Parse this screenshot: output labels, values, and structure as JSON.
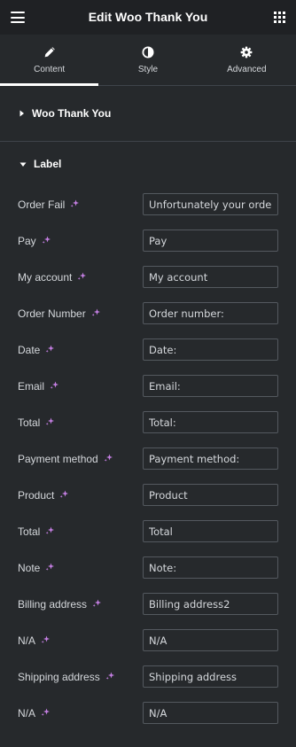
{
  "header": {
    "title": "Edit Woo Thank You"
  },
  "tabs": [
    {
      "label": "Content",
      "icon": "pencil-icon",
      "active": true
    },
    {
      "label": "Style",
      "icon": "contrast-icon",
      "active": false
    },
    {
      "label": "Advanced",
      "icon": "gear-icon",
      "active": false
    }
  ],
  "sections": {
    "woo": {
      "title": "Woo Thank You",
      "expanded": false
    },
    "label": {
      "title": "Label",
      "expanded": true
    }
  },
  "fields": [
    {
      "label": "Order Fail",
      "value": "Unfortunately your order"
    },
    {
      "label": "Pay",
      "value": "Pay"
    },
    {
      "label": "My account",
      "value": "My account"
    },
    {
      "label": "Order Number",
      "value": "Order number:"
    },
    {
      "label": "Date",
      "value": "Date:"
    },
    {
      "label": "Email",
      "value": "Email:"
    },
    {
      "label": "Total",
      "value": "Total:"
    },
    {
      "label": "Payment method",
      "value": "Payment method:"
    },
    {
      "label": "Product",
      "value": "Product"
    },
    {
      "label": "Total",
      "value": "Total"
    },
    {
      "label": "Note",
      "value": "Note:"
    },
    {
      "label": "Billing address",
      "value": "Billing address2"
    },
    {
      "label": "N/A",
      "value": "N/A"
    },
    {
      "label": "Shipping address",
      "value": "Shipping address"
    },
    {
      "label": "N/A",
      "value": "N/A"
    }
  ],
  "colors": {
    "background": "#26292c",
    "header_bg": "#1f2124",
    "ai_icon": "#c780e6",
    "input_border": "#54595f"
  }
}
